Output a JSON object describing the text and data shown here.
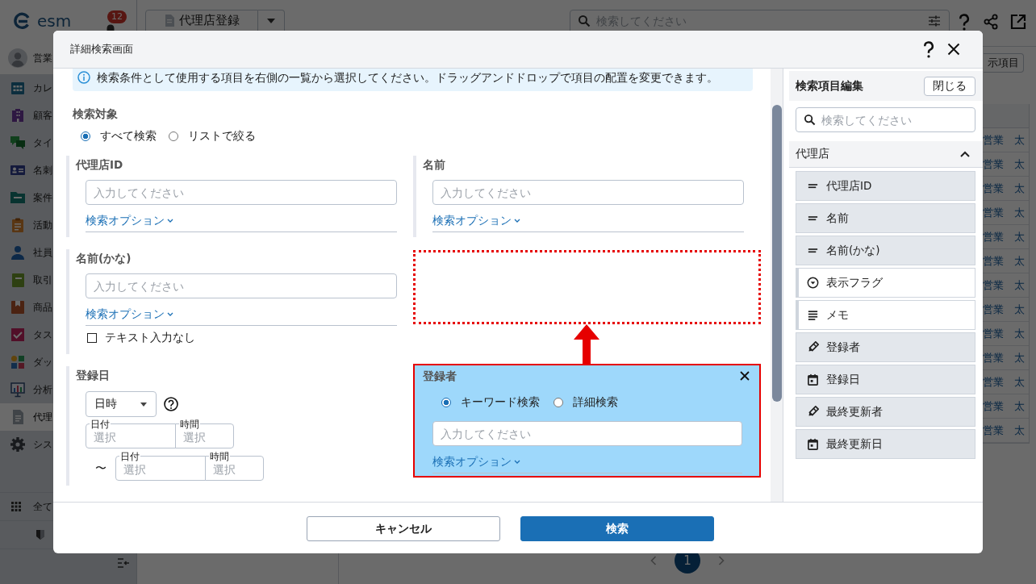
{
  "app": {
    "logo": "esm",
    "notification_count": "12",
    "page_menu": "代理店登録",
    "search": {
      "placeholder": "検索してください"
    },
    "user": "営業",
    "sidebar": [
      {
        "kind": "calendar",
        "label": "カレ",
        "selected": false
      },
      {
        "kind": "building",
        "label": "顧客",
        "selected": false
      },
      {
        "kind": "chat",
        "label": "タイ",
        "selected": false
      },
      {
        "kind": "card",
        "label": "名刺",
        "selected": false
      },
      {
        "kind": "folder",
        "label": "案件",
        "selected": false
      },
      {
        "kind": "clipboard",
        "label": "活動",
        "selected": false
      },
      {
        "kind": "person",
        "label": "社員",
        "selected": false
      },
      {
        "kind": "notebook",
        "label": "取引",
        "selected": false
      },
      {
        "kind": "box",
        "label": "商品",
        "selected": false
      },
      {
        "kind": "task",
        "label": "タス",
        "selected": false
      },
      {
        "kind": "dashboard",
        "label": "ダッ",
        "selected": false
      },
      {
        "kind": "chart",
        "label": "分析",
        "selected": false
      },
      {
        "kind": "document",
        "label": "代理",
        "selected": true
      },
      {
        "kind": "gear",
        "label": "シス",
        "selected": false
      }
    ],
    "sidebar_footer": "全て",
    "view_button": "示項目",
    "table_rows": [
      [
        "営業",
        "太"
      ],
      [
        "営業",
        "太"
      ],
      [
        "営業",
        "太"
      ],
      [
        "営業",
        "太"
      ],
      [
        "営業",
        "太"
      ],
      [
        "営業",
        "太"
      ],
      [
        "営業",
        "太"
      ],
      [
        "営業",
        "太"
      ],
      [
        "営業",
        "太"
      ],
      [
        "営業",
        "太"
      ],
      [
        "営業",
        "太"
      ],
      [
        "営業",
        "太"
      ],
      [
        "営業",
        "太"
      ]
    ],
    "pagination": [
      {
        "label": "1",
        "selected": true
      }
    ]
  },
  "dialog": {
    "title": "詳細検索画面",
    "info": "検索条件として使用する項目を右側の一覧から選択してください。ドラッグアンドドロップで項目の配置を変更できます。",
    "target": {
      "label": "検索対象",
      "options": [
        {
          "label": "すべて検索",
          "selected": true
        },
        {
          "label": "リストで絞る",
          "selected": false
        }
      ]
    },
    "fields": [
      {
        "kind": "text",
        "label": "代理店ID",
        "placeholder": "入力してください",
        "option_link": "検索オプション"
      },
      {
        "kind": "text",
        "label": "名前",
        "placeholder": "入力してください",
        "option_link": "検索オプション"
      },
      {
        "kind": "text",
        "label": "名前(かな)",
        "placeholder": "入力してください",
        "option_link": "検索オプション",
        "no_input_option": {
          "label": "テキスト入力なし",
          "checked": false
        }
      },
      {
        "kind": "drop_zone"
      },
      {
        "kind": "date",
        "label": "登録日",
        "unit": "日時",
        "range": [
          {
            "date_label": "日付",
            "date_placeholder": "選択",
            "time_label": "時間",
            "time_placeholder": "選択"
          },
          {
            "separator": "〜",
            "date_label": "日付",
            "date_placeholder": "選択",
            "time_label": "時間",
            "time_placeholder": "選択"
          }
        ]
      },
      {
        "kind": "user",
        "label": "登録者",
        "dragging": true,
        "options": [
          {
            "label": "キーワード検索",
            "selected": true
          },
          {
            "label": "詳細検索",
            "selected": false
          }
        ],
        "placeholder": "入力してください",
        "option_link": "検索オプション"
      }
    ],
    "buttons": {
      "cancel": "キャンセル",
      "search": "検索"
    }
  },
  "item_panel": {
    "title": "検索項目編集",
    "close": "閉じる",
    "search": {
      "placeholder": "検索してください"
    },
    "group": {
      "label": "代理店",
      "expanded": true
    },
    "items": [
      {
        "label": "代理店ID",
        "kind": "text",
        "added": true
      },
      {
        "label": "名前",
        "kind": "text",
        "added": true
      },
      {
        "label": "名前(かな)",
        "kind": "text",
        "added": true
      },
      {
        "label": "表示フラグ",
        "kind": "dropdown",
        "added": false
      },
      {
        "label": "メモ",
        "kind": "textarea",
        "added": false
      },
      {
        "label": "登録者",
        "kind": "user",
        "added": true
      },
      {
        "label": "登録日",
        "kind": "date",
        "added": true
      },
      {
        "label": "最終更新者",
        "kind": "user",
        "added": true
      },
      {
        "label": "最終更新日",
        "kind": "date",
        "added": true
      }
    ]
  }
}
